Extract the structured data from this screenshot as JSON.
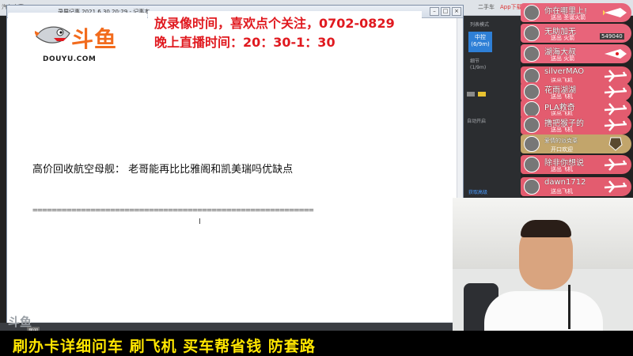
{
  "topbar": {
    "tabs": [
      "汽车之家",
      "二手车",
      "App下载"
    ]
  },
  "window": {
    "title": "录屏记事 2021.6.30 20:29 - 记事本",
    "controls": [
      "–",
      "□",
      "×"
    ]
  },
  "document": {
    "line1": "高价回收航空母舰：   老哥能再比比雅阁和凯美瑞吗优缺点",
    "separator": "=========================================================="
  },
  "app_panel": {
    "mode_label": "列表模式",
    "zk_label": "中控",
    "zk_sub": "(6/9m)",
    "label1": "细节",
    "label2": "(1/9m)",
    "label3": "自动开启",
    "footer": "获取高级"
  },
  "logo": {
    "brand_cn": "斗鱼",
    "brand_en": "DOUYU.COM"
  },
  "notice": {
    "line1": "放录像时间，喜欢点个关注，0702-0829",
    "line2": "晚上直播时间：20：30-1：30"
  },
  "gifts": [
    {
      "name": "你在哪里上!",
      "action": "送出 圣诞火箭"
    },
    {
      "name": "无助加无",
      "action": "送出 火箭",
      "badge": "549040"
    },
    {
      "name": "湖海大叔",
      "action": "送出 火箭"
    },
    {
      "name": "silverMAO",
      "action": "送出飞机"
    },
    {
      "name": "花雨湖湖",
      "action": "送出飞机"
    },
    {
      "name": "PLA救奇",
      "action": "送出飞机"
    },
    {
      "name": "撸把猴子的",
      "action": "送出飞机"
    },
    {
      "name": "爱情的派克菜",
      "action": "开口欢迎"
    },
    {
      "name": "除非你想说",
      "action": "送出飞机"
    },
    {
      "name": "dawn1712",
      "action": "送出飞机"
    }
  ],
  "room": {
    "logo": "斗鱼",
    "tag": "房间号"
  },
  "banner": {
    "text": "刷办卡详细问车  刷飞机  买车帮省钱  防套路"
  },
  "colors": {
    "red": "#e0191f",
    "orange": "#f26b1d",
    "yellow": "#ffe600",
    "gift_pink": "#e8647a"
  }
}
